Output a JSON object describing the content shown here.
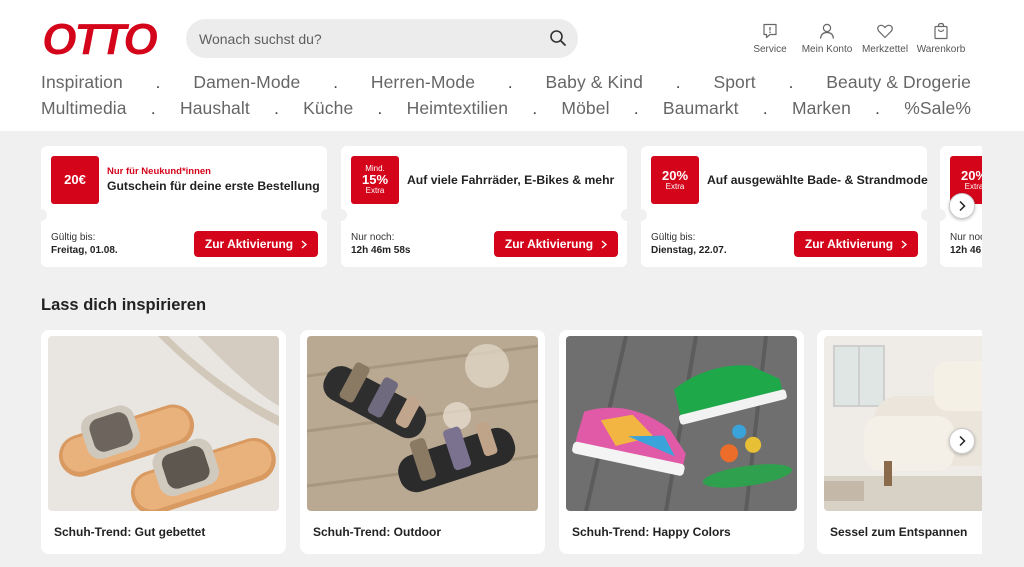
{
  "brand": {
    "logo_text": "OTTO",
    "color": "#d4051b"
  },
  "search": {
    "placeholder": "Wonach suchst du?"
  },
  "header_icons": [
    {
      "label": "Service",
      "icon": "service-icon"
    },
    {
      "label": "Mein Konto",
      "icon": "account-icon"
    },
    {
      "label": "Merkzettel",
      "icon": "heart-icon"
    },
    {
      "label": "Warenkorb",
      "icon": "cart-icon"
    }
  ],
  "nav": {
    "row1": [
      "Inspiration",
      "Damen-Mode",
      "Herren-Mode",
      "Baby & Kind",
      "Sport",
      "Beauty & Drogerie"
    ],
    "row2": [
      "Multimedia",
      "Haushalt",
      "Küche",
      "Heimtextilien",
      "Möbel",
      "Baumarkt",
      "Marken",
      "%Sale%"
    ],
    "separator": "."
  },
  "promos": [
    {
      "badge_big": "20€",
      "badge_top": "",
      "badge_bottom": "",
      "subtitle": "Nur für Neukund*innen",
      "title": "Gutschein für deine erste Bestellung",
      "label": "Gültig bis:",
      "value": "Freitag, 01.08.",
      "cta": "Zur Aktivierung"
    },
    {
      "badge_big": "15%",
      "badge_top": "Mind.",
      "badge_bottom": "Extra",
      "subtitle": "",
      "title": "Auf viele Fahrräder, E-Bikes & mehr",
      "label": "Nur noch:",
      "value": "12h 46m 58s",
      "cta": "Zur Aktivierung"
    },
    {
      "badge_big": "20%",
      "badge_top": "",
      "badge_bottom": "Extra",
      "subtitle": "",
      "title": "Auf ausgewählte Bade- & Strandmode",
      "label": "Gültig bis:",
      "value": "Dienstag, 22.07.",
      "cta": "Zur Aktivierung"
    },
    {
      "badge_big": "20%",
      "badge_top": "",
      "badge_bottom": "Extra",
      "subtitle": "",
      "title": "",
      "label": "Nur noch:",
      "value": "12h 46",
      "cta": ""
    }
  ],
  "inspiration": {
    "title": "Lass dich inspirieren",
    "tiles": [
      {
        "caption": "Schuh-Trend: Gut gebettet"
      },
      {
        "caption": "Schuh-Trend: Outdoor"
      },
      {
        "caption": "Schuh-Trend: Happy Colors"
      },
      {
        "caption": "Sessel zum Entspannen"
      }
    ]
  }
}
